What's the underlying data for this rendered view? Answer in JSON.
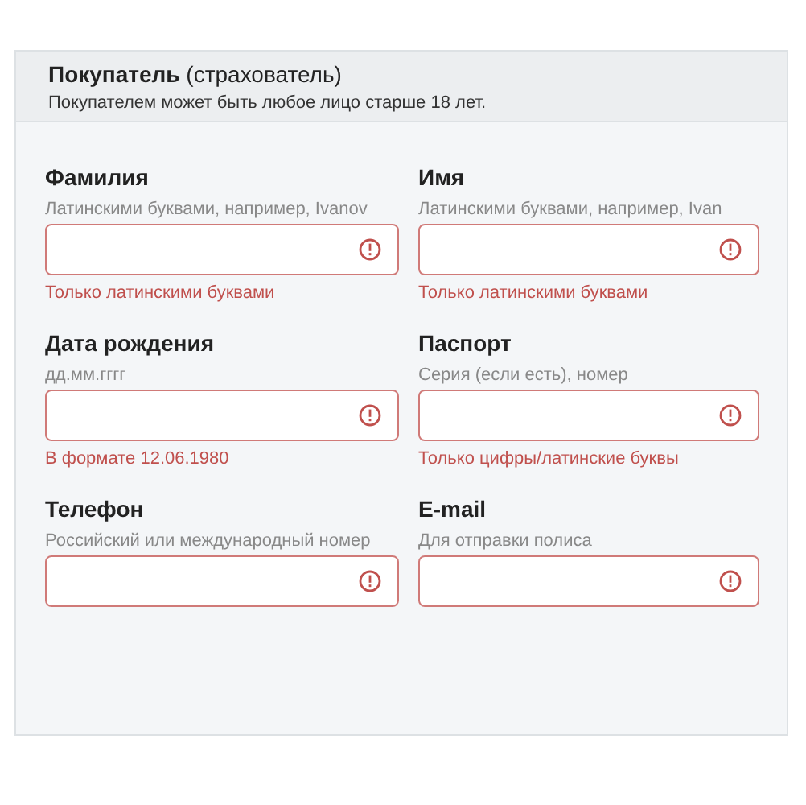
{
  "header": {
    "title": "**Покупатель** (страхователь)",
    "subtitle": "Покупателем может быть любое лицо старше 18 лет."
  },
  "fields": [
    {
      "label": "Фамилия",
      "hint": "Латинскими буквами, например, Ivanov",
      "invalid": true,
      "error": "Только латинскими буквами"
    },
    {
      "label": "Имя",
      "hint": "Латинскими буквами, например, Ivan",
      "invalid": true,
      "error": "Только латинскими буквами"
    },
    {
      "label": "Дата рождения",
      "hint": "дд.мм.гггг",
      "invalid": true,
      "error": "В формате 12.06.1980"
    },
    {
      "label": "Паспорт",
      "hint": "Серия (если есть), номер",
      "invalid": true,
      "error": "Только цифры/латинские буквы"
    },
    {
      "label": "Телефон",
      "hint": "Российский или международный номер",
      "invalid": true
    },
    {
      "label": "E-mail",
      "hint": "Для отправки полиса",
      "invalid": true
    }
  ]
}
